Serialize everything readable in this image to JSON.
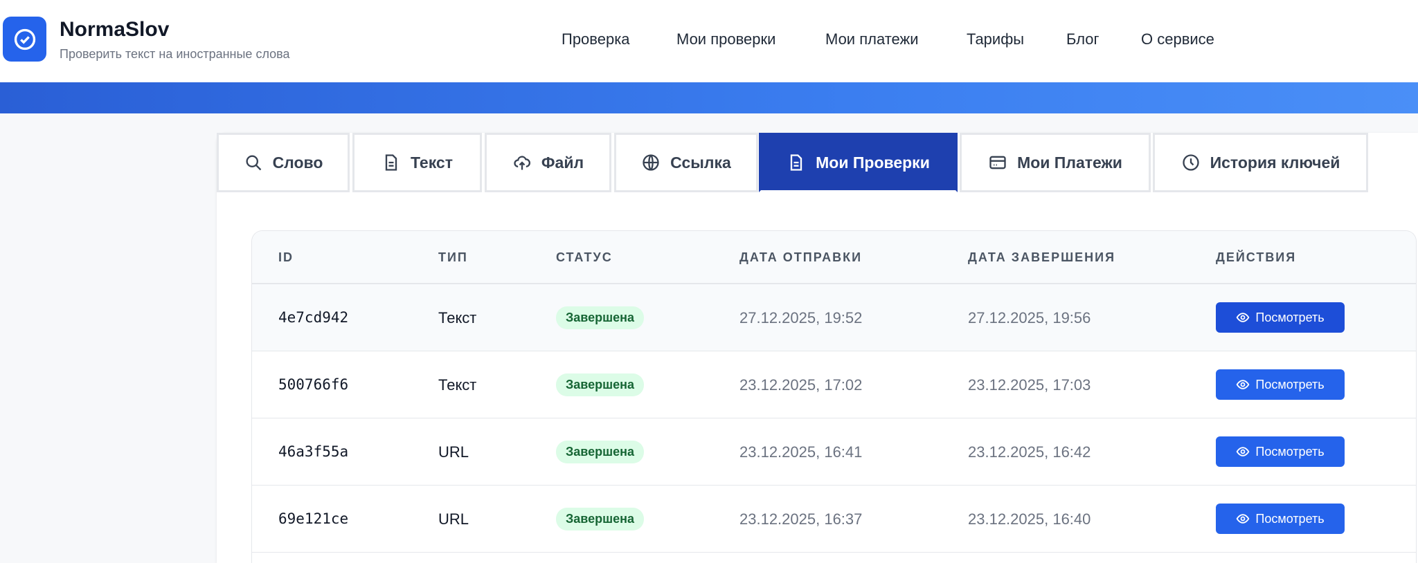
{
  "header": {
    "brand": "NormaSlov",
    "tagline": "Проверить текст на иностранные слова",
    "nav": [
      "Проверка",
      "Мои проверки",
      "Мои платежи",
      "Тарифы",
      "Блог",
      "О сервисе"
    ]
  },
  "tabs": [
    {
      "label": "Слово",
      "icon": "search-icon"
    },
    {
      "label": "Текст",
      "icon": "document-icon"
    },
    {
      "label": "Файл",
      "icon": "cloud-upload-icon"
    },
    {
      "label": "Ссылка",
      "icon": "globe-icon"
    },
    {
      "label": "Мои Проверки",
      "icon": "document-icon",
      "active": true
    },
    {
      "label": "Мои Платежи",
      "icon": "credit-card-icon"
    },
    {
      "label": "История ключей",
      "icon": "clock-icon"
    }
  ],
  "table": {
    "headers": [
      "ID",
      "ТИП",
      "СТАТУС",
      "ДАТА ОТПРАВКИ",
      "ДАТА ЗАВЕРШЕНИЯ",
      "ДЕЙСТВИЯ"
    ],
    "rows": [
      {
        "id": "4e7cd942",
        "type": "Текст",
        "status": "Завершена",
        "sent": "27.12.2025, 19:52",
        "done": "27.12.2025, 19:56",
        "action": "Посмотреть"
      },
      {
        "id": "500766f6",
        "type": "Текст",
        "status": "Завершена",
        "sent": "23.12.2025, 17:02",
        "done": "23.12.2025, 17:03",
        "action": "Посмотреть"
      },
      {
        "id": "46a3f55a",
        "type": "URL",
        "status": "Завершена",
        "sent": "23.12.2025, 16:41",
        "done": "23.12.2025, 16:42",
        "action": "Посмотреть"
      },
      {
        "id": "69e121ce",
        "type": "URL",
        "status": "Завершена",
        "sent": "23.12.2025, 16:37",
        "done": "23.12.2025, 16:40",
        "action": "Посмотреть"
      }
    ]
  },
  "colors": {
    "accent": "#2563eb",
    "active_tab": "#1e40af",
    "badge_bg": "#dcfce7",
    "badge_text": "#166534"
  }
}
